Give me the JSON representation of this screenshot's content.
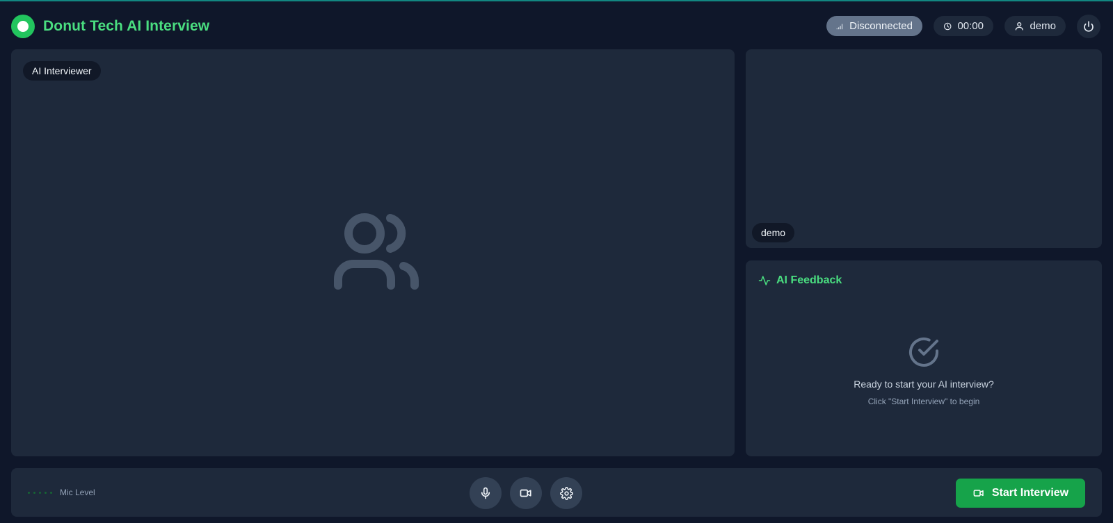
{
  "header": {
    "title": "Donut Tech AI Interview",
    "status": "Disconnected",
    "timer": "00:00",
    "user": "demo"
  },
  "main_video": {
    "label": "AI Interviewer"
  },
  "self_video": {
    "label": "demo"
  },
  "feedback": {
    "title": "AI Feedback",
    "empty_title": "Ready to start your AI interview?",
    "empty_subtitle": "Click \"Start Interview\" to begin"
  },
  "controls": {
    "mic_level_label": "Mic Level",
    "start_label": "Start Interview"
  },
  "icons": {
    "brand": "logo-circle-icon",
    "status": "signal-icon",
    "timer": "clock-icon",
    "user": "user-icon",
    "power": "power-icon",
    "placeholder": "users-icon",
    "feedback": "activity-icon",
    "check": "check-circle-icon",
    "mic": "mic-icon",
    "camera": "video-icon",
    "settings": "gear-icon"
  },
  "colors": {
    "accent": "#4ade80",
    "primary_button": "#16a34a",
    "background": "#0f172a",
    "panel": "#1e293b",
    "status_pill": "#64748b"
  }
}
